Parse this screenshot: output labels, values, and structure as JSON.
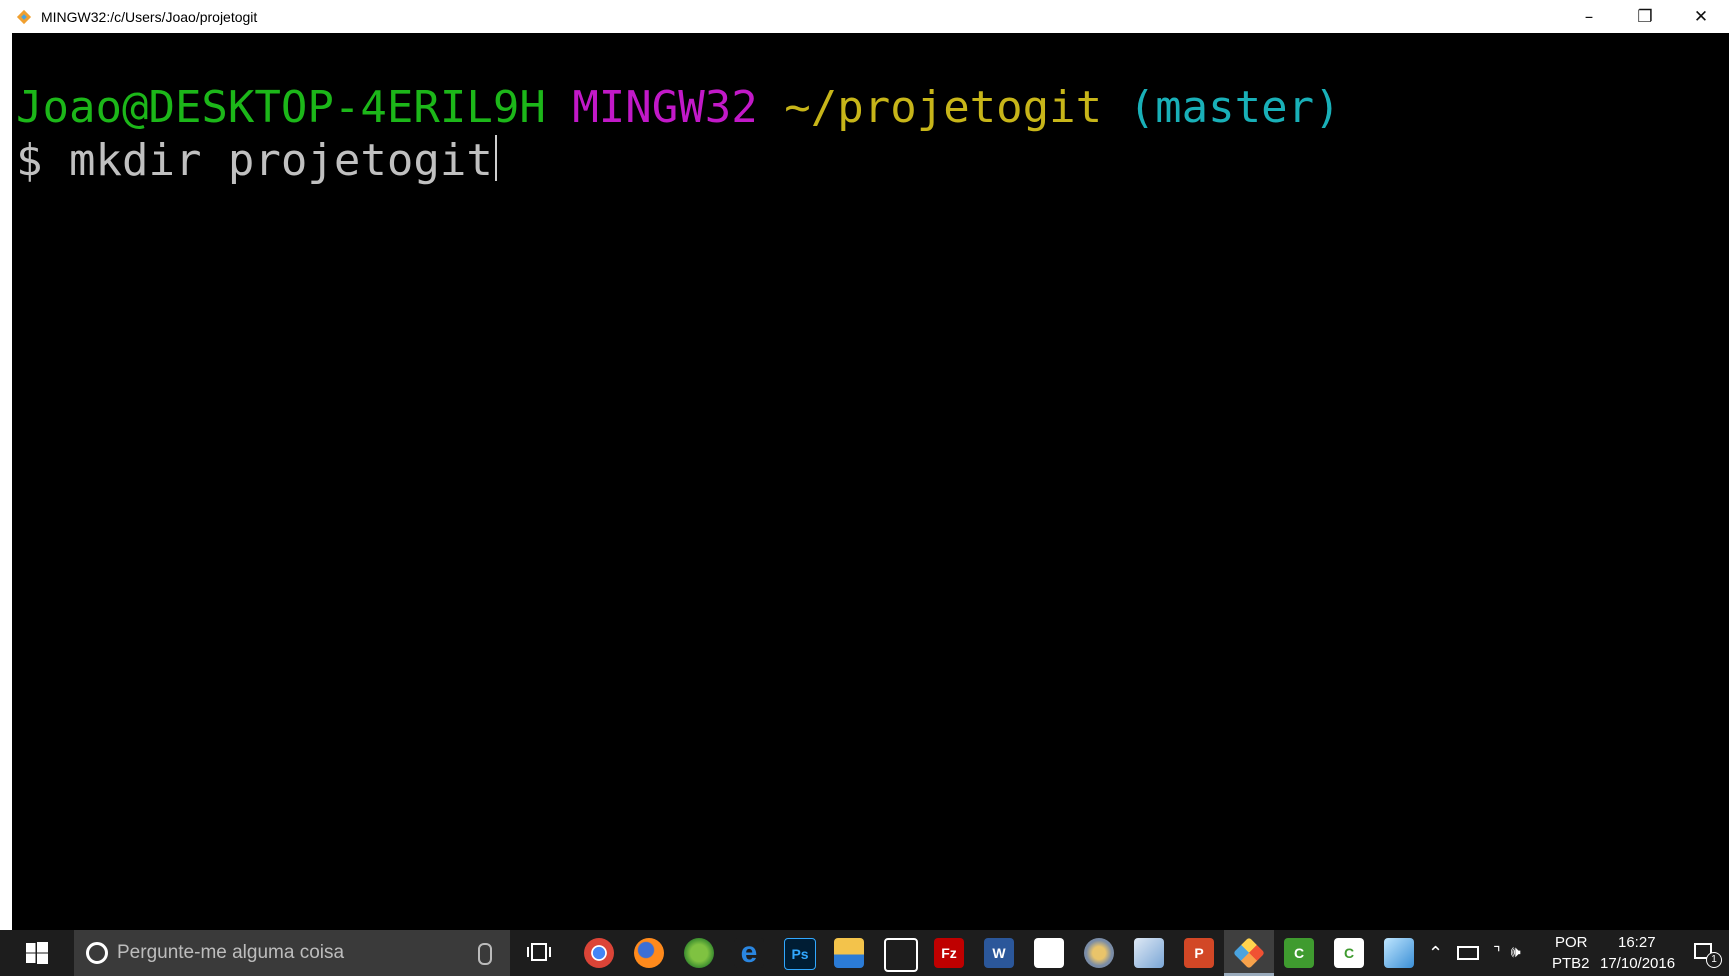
{
  "window": {
    "title": "MINGW32:/c/Users/Joao/projetogit",
    "controls": {
      "minimize": "–",
      "restore": "❐",
      "close": "✕"
    }
  },
  "terminal": {
    "prompt": {
      "user_host": "Joao@DESKTOP-4ERIL9H",
      "system": "MINGW32",
      "path": "~/projetogit",
      "branch": "(master)"
    },
    "command_prefix": "$ ",
    "command": "mkdir projetogit",
    "colors": {
      "user_host": "#1cb719",
      "system": "#c219c8",
      "path": "#c7b519",
      "branch": "#19b0b8",
      "command": "#c0c0c0"
    }
  },
  "taskbar": {
    "search_placeholder": "Pergunte-me alguma coisa",
    "apps": [
      {
        "name": "chrome-icon",
        "label": ""
      },
      {
        "name": "firefox-icon",
        "label": ""
      },
      {
        "name": "globe-app-icon",
        "label": ""
      },
      {
        "name": "edge-icon",
        "label": "e"
      },
      {
        "name": "photoshop-icon",
        "label": "Ps"
      },
      {
        "name": "file-explorer-icon",
        "label": ""
      },
      {
        "name": "store-icon",
        "label": ""
      },
      {
        "name": "filezilla-icon",
        "label": "Fz"
      },
      {
        "name": "word-icon",
        "label": "W"
      },
      {
        "name": "camera-icon",
        "label": ""
      },
      {
        "name": "paint-icon",
        "label": ""
      },
      {
        "name": "box-app-icon",
        "label": ""
      },
      {
        "name": "powerpoint-icon",
        "label": "P"
      },
      {
        "name": "git-bash-icon",
        "label": ""
      },
      {
        "name": "camtasia-icon",
        "label": "C"
      },
      {
        "name": "camtasia-recorder-icon",
        "label": "C"
      },
      {
        "name": "notes-app-icon",
        "label": ""
      }
    ],
    "tray": {
      "lang_top": "POR",
      "lang_bottom": "PTB2",
      "time": "16:27",
      "date": "17/10/2016",
      "notification_count": "1"
    }
  }
}
